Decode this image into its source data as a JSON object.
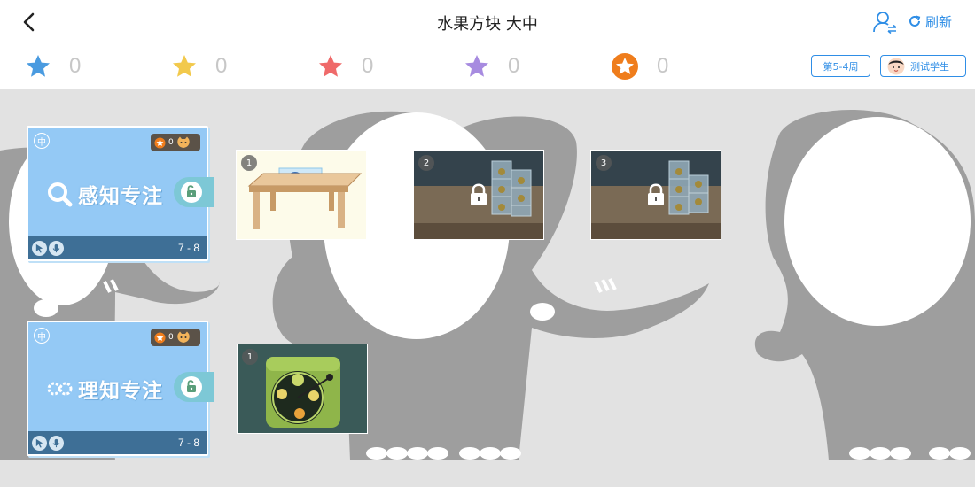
{
  "header": {
    "title": "水果方块 大中",
    "refresh_label": "刷新",
    "back_icon": "chevron-left-icon",
    "switch_user_icon": "switch-user-icon",
    "refresh_icon": "refresh-icon"
  },
  "stars": [
    {
      "color_name": "blue",
      "color": "#4a9be0",
      "count": "0"
    },
    {
      "color_name": "yellow",
      "color": "#f2c94c",
      "count": "0"
    },
    {
      "color_name": "red",
      "color": "#ef6a6a",
      "count": "0"
    },
    {
      "color_name": "purple",
      "color": "#a78be0",
      "count": "0"
    },
    {
      "color_name": "orange-badge",
      "color": "#ef7d1c",
      "count": "0"
    }
  ],
  "week_label": "第5-4周",
  "student_name": "测试学生",
  "modules": [
    {
      "level": "中",
      "reward_count": "0",
      "name": "感知专注",
      "icon": "magnifier-icon",
      "age": "7 - 8",
      "games": [
        {
          "number": "1",
          "desc": "table-with-blocks",
          "locked": false
        },
        {
          "number": "2",
          "desc": "stacked-ice-blocks",
          "locked": true
        },
        {
          "number": "3",
          "desc": "stacked-ice-blocks",
          "locked": true
        }
      ]
    },
    {
      "level": "中",
      "reward_count": "0",
      "name": "理知专注",
      "icon": "gears-icon",
      "age": "7 - 8",
      "games": [
        {
          "number": "1",
          "desc": "fruit-wheel-box",
          "locked": false
        }
      ]
    }
  ],
  "colors": {
    "accent": "#2f8ee6",
    "card_blue": "#94c9f5",
    "card_footer": "#3e6f96",
    "background": "#e2e2e2"
  }
}
